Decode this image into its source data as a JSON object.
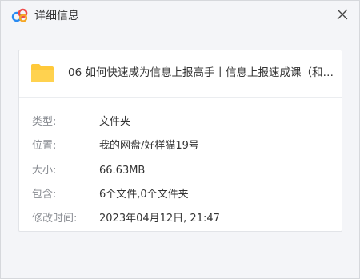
{
  "window": {
    "title": "详细信息",
    "logo_icon": "baidu-netdisk-logo-icon",
    "close_icon": "close-icon",
    "accent_colors": [
      "#2a8bf2",
      "#f5a623",
      "#ef4b4b"
    ]
  },
  "file": {
    "icon": "folder-icon",
    "icon_color": "#ffc93a",
    "name": "06 如何快速成为信息上报高手丨信息上报速成课（和颜..."
  },
  "details": [
    {
      "key": "type",
      "label": "类型:",
      "value": "文件夹"
    },
    {
      "key": "location",
      "label": "位置:",
      "value": "我的网盘/好样猫19号"
    },
    {
      "key": "size",
      "label": "大小:",
      "value": "66.63MB"
    },
    {
      "key": "contents",
      "label": "包含:",
      "value": "6个文件,0个文件夹"
    },
    {
      "key": "modified",
      "label": "修改时间:",
      "value": "2023年04月12日, 21:47"
    }
  ]
}
